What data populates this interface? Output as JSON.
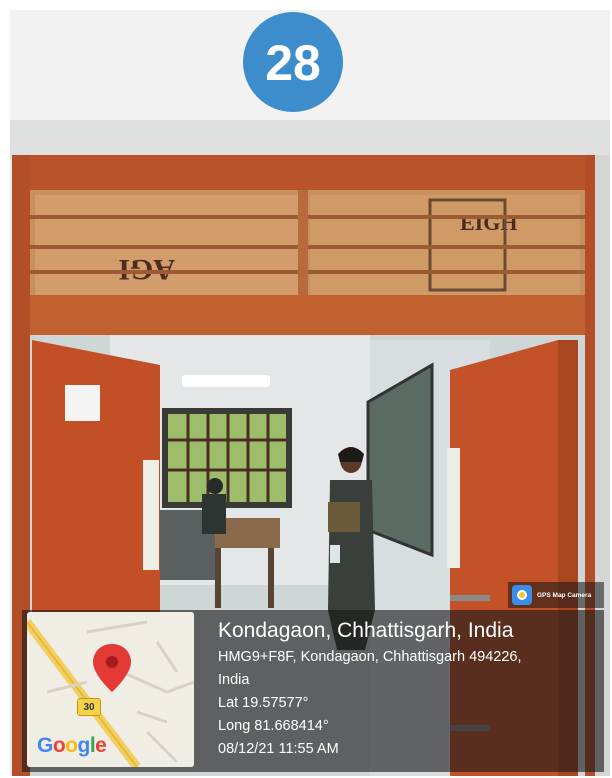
{
  "room_number": "28",
  "door_note": "",
  "badge": {
    "label": "GPS Map Camera",
    "icon": "camera-icon"
  },
  "geo": {
    "title": "Kondagaon, Chhattisgarh, India",
    "address_line1": "HMG9+F8F, Kondagaon, Chhattisgarh 494226,",
    "address_line2": "India",
    "lat": "Lat 19.57577°",
    "long": "Long 81.668414°",
    "datetime": "08/12/21 11:55 AM"
  },
  "map": {
    "route_label": "30",
    "logo": {
      "letters": [
        "G",
        "o",
        "o",
        "g",
        "l",
        "e"
      ],
      "colors": [
        "#4285F4",
        "#EA4335",
        "#FBBC05",
        "#4285F4",
        "#34A853",
        "#EA4335"
      ]
    },
    "pin_color": "#e53935"
  },
  "colors": {
    "door": "#c0542a",
    "wall": "#eef0ef",
    "badge_blue": "#3d8ccb"
  }
}
